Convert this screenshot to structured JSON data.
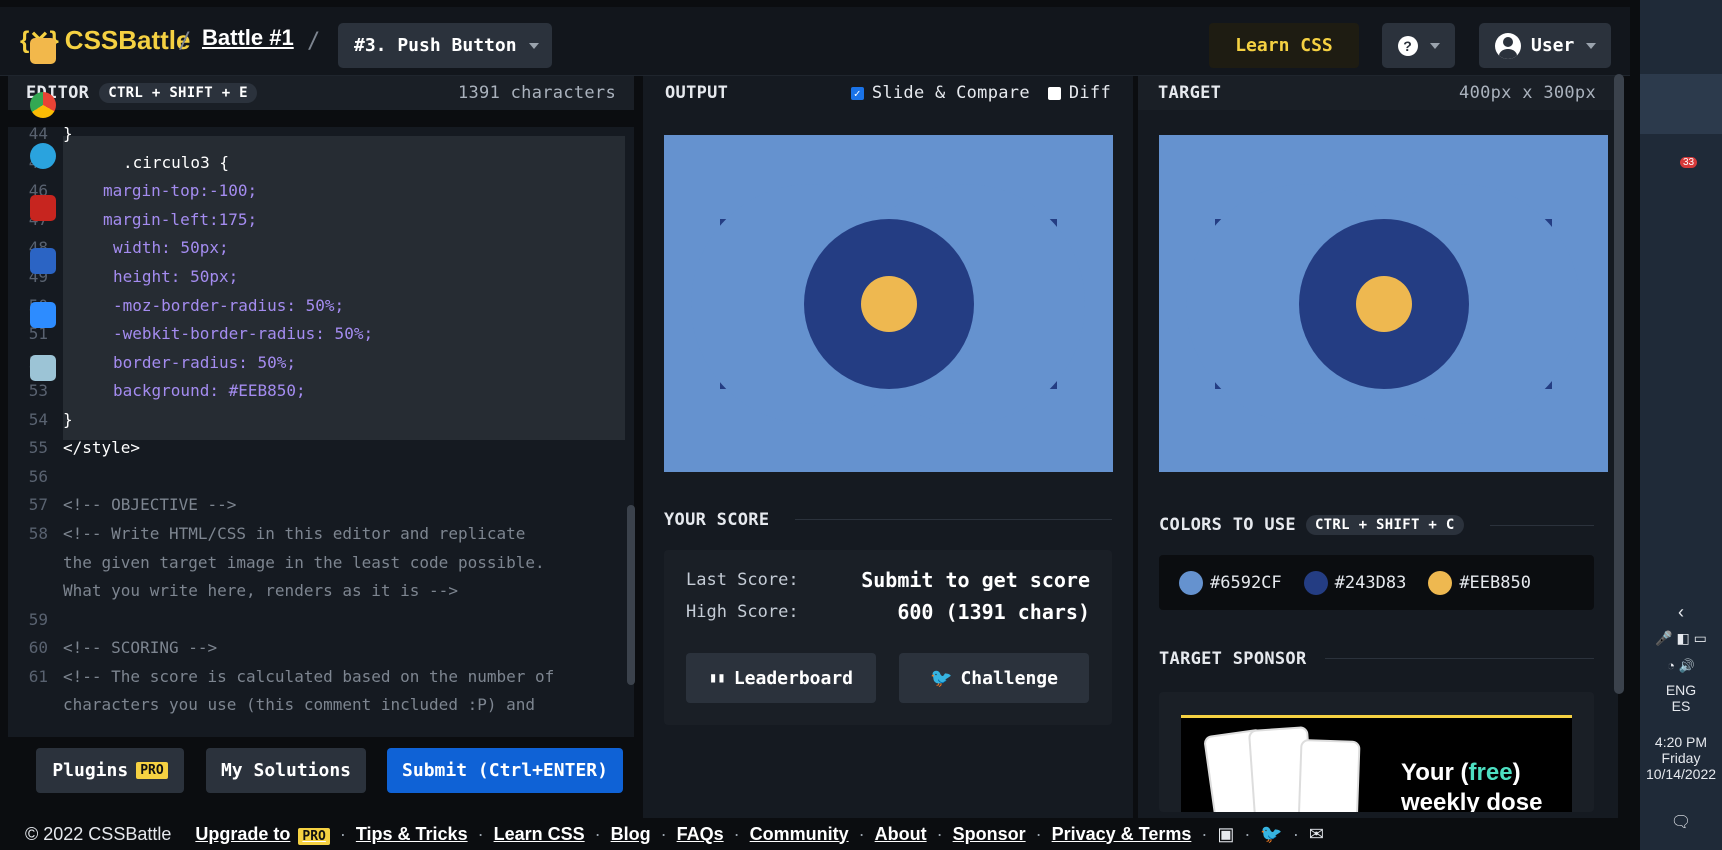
{
  "header": {
    "logo": "CSSBattle",
    "battle": "Battle #1",
    "target_name": "#3. Push Button",
    "learn_css": "Learn CSS",
    "help": "?",
    "user": "User"
  },
  "editor": {
    "label": "EDITOR",
    "shortcut": "CTRL + SHIFT + E",
    "char_count": "1391 characters",
    "plugins": "Plugins",
    "pro": "PRO",
    "my_solutions": "My Solutions",
    "submit": "Submit (Ctrl+ENTER)"
  },
  "code": {
    "lines": [
      {
        "n": "44",
        "t": "}"
      },
      {
        "n": "45",
        "t": ".circulo3 {"
      },
      {
        "n": "46",
        "t": "margin-top:-100;"
      },
      {
        "n": "47",
        "t": "margin-left:175;"
      },
      {
        "n": "48",
        "t": "width: 50px;"
      },
      {
        "n": "49",
        "t": "height: 50px;"
      },
      {
        "n": "50",
        "t": "-moz-border-radius: 50%;"
      },
      {
        "n": "51",
        "t": "-webkit-border-radius: 50%;"
      },
      {
        "n": "52",
        "t": "border-radius: 50%;"
      },
      {
        "n": "53",
        "t": "background: #EEB850;"
      },
      {
        "n": "54",
        "t": "}"
      },
      {
        "n": "55",
        "t": "</style>"
      },
      {
        "n": "56",
        "t": ""
      },
      {
        "n": "57",
        "t": "<!-- OBJECTIVE -->"
      },
      {
        "n": "58",
        "t": "<!-- Write HTML/CSS in this editor and replicate"
      },
      {
        "n": "",
        "t": "the given target image in the least code possible."
      },
      {
        "n": "",
        "t": "What you write here, renders as it is -->"
      },
      {
        "n": "59",
        "t": ""
      },
      {
        "n": "60",
        "t": "<!-- SCORING -->"
      },
      {
        "n": "61",
        "t": "<!-- The score is calculated based on the number of"
      },
      {
        "n": "",
        "t": "characters you use (this comment included :P) and"
      }
    ]
  },
  "output": {
    "label": "OUTPUT",
    "slide_compare": "Slide & Compare",
    "diff": "Diff",
    "slide_checked": true,
    "diff_checked": false
  },
  "target": {
    "label": "TARGET",
    "size": "400px x 300px"
  },
  "score": {
    "title": "YOUR SCORE",
    "last_label": "Last Score:",
    "last_value": "Submit to get score",
    "high_label": "High Score:",
    "high_value": "600 (1391 chars)",
    "leaderboard": "Leaderboard",
    "challenge": "Challenge"
  },
  "colors": {
    "title": "COLORS TO USE",
    "shortcut": "CTRL + SHIFT + C",
    "list": [
      {
        "hex": "#6592CF",
        "color": "#6592cf"
      },
      {
        "hex": "#243D83",
        "color": "#243d83"
      },
      {
        "hex": "#EEB850",
        "color": "#eeb850"
      }
    ]
  },
  "sponsor": {
    "title": "TARGET SPONSOR",
    "ad_line1_a": "Your (",
    "ad_free": "free",
    "ad_line1_b": ")",
    "ad_line2": "weekly dose"
  },
  "footer": {
    "copyright": "© 2022 CSSBattle",
    "upgrade": "Upgrade to",
    "pro": "PRO",
    "tips": "Tips & Tricks",
    "learn": "Learn CSS",
    "blog": "Blog",
    "faqs": "FAQs",
    "community": "Community",
    "about": "About",
    "sponsor": "Sponsor",
    "privacy": "Privacy & Terms"
  },
  "system": {
    "lang1": "ENG",
    "lang2": "ES",
    "time": "4:20 PM",
    "day": "Friday",
    "date": "10/14/2022",
    "telegram_badge": "33"
  }
}
